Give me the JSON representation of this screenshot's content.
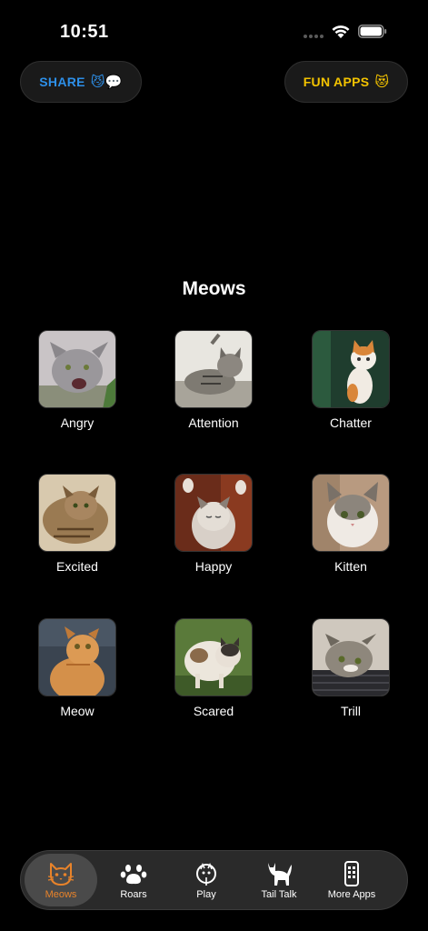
{
  "status_bar": {
    "time": "10:51"
  },
  "top_buttons": {
    "share": {
      "label": "SHARE",
      "emoji": "😼💬"
    },
    "fun_apps": {
      "label": "FUN APPS",
      "emoji": "😻"
    }
  },
  "section": {
    "title": "Meows"
  },
  "sounds": [
    {
      "label": "Angry",
      "icon": "gray-cat-hissing-photo"
    },
    {
      "label": "Attention",
      "icon": "tabby-cat-crouching-photo"
    },
    {
      "label": "Chatter",
      "icon": "orange-white-kitten-photo"
    },
    {
      "label": "Excited",
      "icon": "tabby-cat-lying-photo"
    },
    {
      "label": "Happy",
      "icon": "fluffy-kitten-stretching-photo"
    },
    {
      "label": "Kitten",
      "icon": "tabby-white-kitten-photo"
    },
    {
      "label": "Meow",
      "icon": "orange-cat-looking-up-photo"
    },
    {
      "label": "Scared",
      "icon": "calico-cat-arched-photo"
    },
    {
      "label": "Trill",
      "icon": "tabby-cat-resting-photo"
    }
  ],
  "tab_bar": {
    "items": [
      {
        "label": "Meows",
        "icon": "cat-face-icon",
        "active": true
      },
      {
        "label": "Roars",
        "icon": "paw-icon",
        "active": false
      },
      {
        "label": "Play",
        "icon": "cat-toy-icon",
        "active": false
      },
      {
        "label": "Tail Talk",
        "icon": "cat-silhouette-icon",
        "active": false
      },
      {
        "label": "More Apps",
        "icon": "phone-apps-icon",
        "active": false
      }
    ]
  },
  "colors": {
    "background": "#000000",
    "share_text": "#2d8fe8",
    "fun_apps_text": "#f3c300",
    "active_tab": "#e8832a"
  }
}
